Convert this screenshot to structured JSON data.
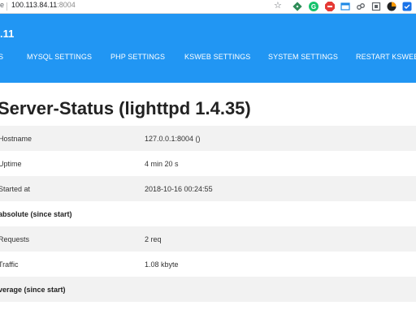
{
  "browser": {
    "url_fragment": "e",
    "url_host": "100.113.84.11",
    "url_port": ":8004",
    "star_icon": "star-icon",
    "extensions": [
      {
        "name": "green-diamond-extension-icon",
        "color": "#2e8b57"
      },
      {
        "name": "grammarly-icon",
        "color": "#15c26b"
      },
      {
        "name": "adblock-icon",
        "color": "#e53935"
      },
      {
        "name": "window-extension-icon",
        "color": "#1e88e5"
      },
      {
        "name": "link-extension-icon",
        "color": "#5f6368"
      },
      {
        "name": "cast-extension-icon",
        "color": "#5f6368"
      },
      {
        "name": "orange-circle-extension-icon",
        "color": "#ff9800"
      },
      {
        "name": "blue-square-extension-icon",
        "color": "#1a73e8"
      }
    ]
  },
  "appbar": {
    "title": ".11",
    "color": "#2196f3",
    "tabs": [
      {
        "label": "S"
      },
      {
        "label": "MYSQL SETTINGS"
      },
      {
        "label": "PHP SETTINGS"
      },
      {
        "label": "KSWEB SETTINGS"
      },
      {
        "label": "SYSTEM SETTINGS"
      },
      {
        "label": "RESTART KSWEB"
      }
    ]
  },
  "page": {
    "title": "Server-Status (lighttpd 1.4.35)"
  },
  "status_rows": [
    {
      "label": "Hostname",
      "value": "127.0.0.1:8004 ()"
    },
    {
      "label": "Uptime",
      "value": "4 min 20 s"
    },
    {
      "label": "Started at",
      "value": "2018-10-16 00:24:55"
    },
    {
      "label": "absolute (since start)",
      "value": ""
    },
    {
      "label": "Requests",
      "value": "2 req"
    },
    {
      "label": "Traffic",
      "value": "1.08 kbyte"
    },
    {
      "label": "verage (since start)",
      "value": ""
    },
    {
      "label": "",
      "value": ""
    }
  ]
}
